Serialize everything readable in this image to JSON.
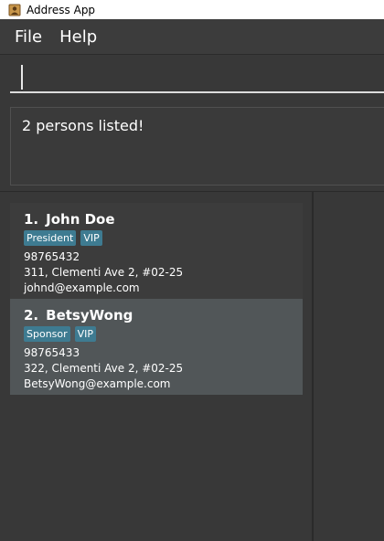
{
  "window": {
    "title": "Address App"
  },
  "menu": {
    "file": "File",
    "help": "Help"
  },
  "command": {
    "value": "",
    "placeholder": ""
  },
  "result": {
    "message": "2 persons listed!"
  },
  "persons": [
    {
      "index": "1.",
      "name": "John Doe",
      "tags": [
        "President",
        "VIP"
      ],
      "phone": "98765432",
      "address": "311, Clementi Ave 2, #02-25",
      "email": "johnd@example.com"
    },
    {
      "index": "2.",
      "name": "BetsyWong",
      "tags": [
        "Sponsor",
        "VIP"
      ],
      "phone": "98765433",
      "address": "322, Clementi Ave 2, #02-25",
      "email": "BetsyWong@example.com"
    }
  ],
  "colors": {
    "background": "#383838",
    "card_alt": "#515658",
    "tag": "#3e7b91",
    "text": "#ffffff"
  },
  "icons": {
    "app": "address-book-icon"
  }
}
